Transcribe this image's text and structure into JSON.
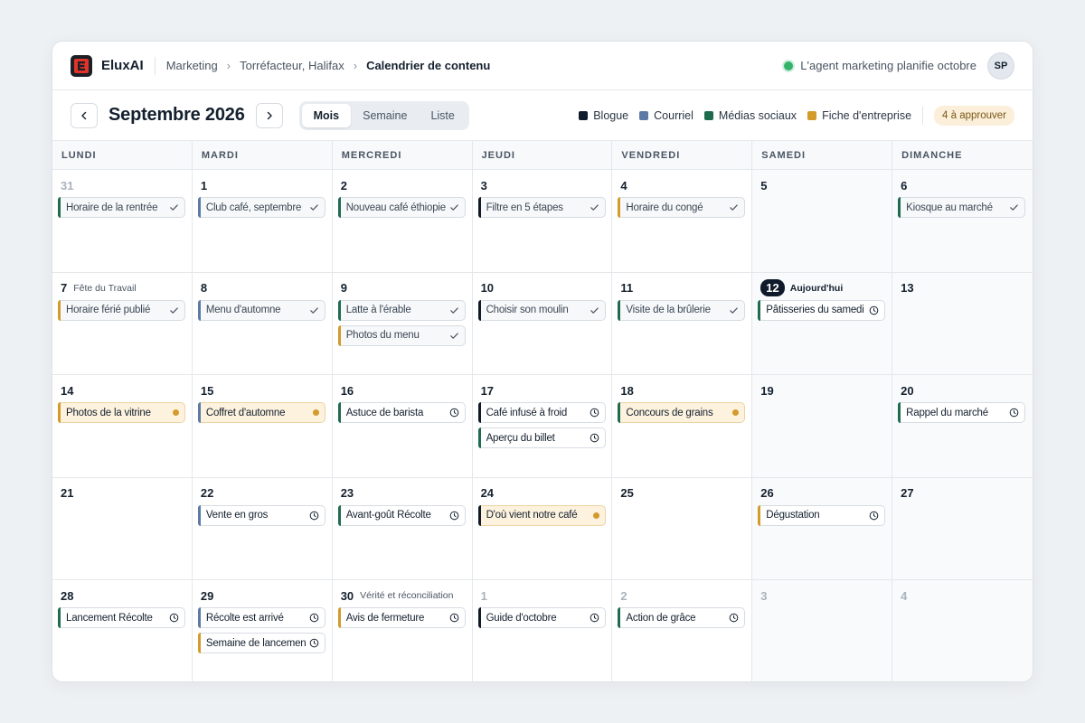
{
  "app": {
    "brand": "EluxAI"
  },
  "breadcrumb": [
    "Marketing",
    "Torréfacteur, Halifax",
    "Calendrier de contenu"
  ],
  "status": {
    "text": "L'agent marketing planifie octobre",
    "color": "#33b36b"
  },
  "user": {
    "initials": "SP"
  },
  "toolbar": {
    "month_title": "Septembre 2026",
    "views": [
      "Mois",
      "Semaine",
      "Liste"
    ],
    "active_view": "Mois",
    "approve_badge": "4 à approuver"
  },
  "legend": [
    {
      "label": "Blogue",
      "color": "#0f1a2a"
    },
    {
      "label": "Courriel",
      "color": "#5b7ba6"
    },
    {
      "label": "Médias sociaux",
      "color": "#1f6b4f"
    },
    {
      "label": "Fiche d'entreprise",
      "color": "#d39a2c"
    }
  ],
  "weekdays": [
    "LUNDI",
    "MARDI",
    "MERCREDI",
    "JEUDI",
    "VENDREDI",
    "SAMEDI",
    "DIMANCHE"
  ],
  "days": [
    {
      "num": "31",
      "muted": true,
      "events": [
        {
          "title": "Horaire de la rentrée",
          "cat": "social",
          "state": "done"
        }
      ]
    },
    {
      "num": "1",
      "events": [
        {
          "title": "Club café, septembre",
          "cat": "email",
          "state": "done"
        }
      ]
    },
    {
      "num": "2",
      "events": [
        {
          "title": "Nouveau café éthiopien",
          "cat": "social",
          "state": "done"
        }
      ]
    },
    {
      "num": "3",
      "events": [
        {
          "title": "Filtre en 5 étapes",
          "cat": "blog",
          "state": "done"
        }
      ]
    },
    {
      "num": "4",
      "events": [
        {
          "title": "Horaire du congé",
          "cat": "listing",
          "state": "done"
        }
      ]
    },
    {
      "num": "5",
      "events": []
    },
    {
      "num": "6",
      "events": [
        {
          "title": "Kiosque au marché",
          "cat": "social",
          "state": "done"
        }
      ]
    },
    {
      "num": "7",
      "note": "Fête du Travail",
      "events": [
        {
          "title": "Horaire férié publié",
          "cat": "listing",
          "state": "done"
        }
      ]
    },
    {
      "num": "8",
      "events": [
        {
          "title": "Menu d'automne",
          "cat": "email",
          "state": "done"
        }
      ]
    },
    {
      "num": "9",
      "events": [
        {
          "title": "Latte à l'érable",
          "cat": "social",
          "state": "done"
        },
        {
          "title": "Photos du menu",
          "cat": "listing",
          "state": "done"
        }
      ]
    },
    {
      "num": "10",
      "events": [
        {
          "title": "Choisir son moulin",
          "cat": "blog",
          "state": "done"
        }
      ]
    },
    {
      "num": "11",
      "events": [
        {
          "title": "Visite de la brûlerie",
          "cat": "social",
          "state": "done"
        }
      ]
    },
    {
      "num": "12",
      "today": true,
      "note": "Aujourd'hui",
      "events": [
        {
          "title": "Pâtisseries du samedi",
          "cat": "social",
          "state": "scheduled"
        }
      ]
    },
    {
      "num": "13",
      "events": []
    },
    {
      "num": "14",
      "events": [
        {
          "title": "Photos de la vitrine",
          "cat": "listing",
          "state": "pending"
        }
      ]
    },
    {
      "num": "15",
      "events": [
        {
          "title": "Coffret d'automne",
          "cat": "email",
          "state": "pending"
        }
      ]
    },
    {
      "num": "16",
      "events": [
        {
          "title": "Astuce de barista",
          "cat": "social",
          "state": "scheduled"
        }
      ]
    },
    {
      "num": "17",
      "events": [
        {
          "title": "Café infusé à froid",
          "cat": "blog",
          "state": "scheduled"
        },
        {
          "title": "Aperçu du billet",
          "cat": "social",
          "state": "scheduled"
        }
      ]
    },
    {
      "num": "18",
      "events": [
        {
          "title": "Concours de grains",
          "cat": "social",
          "state": "pending"
        }
      ]
    },
    {
      "num": "19",
      "events": []
    },
    {
      "num": "20",
      "events": [
        {
          "title": "Rappel du marché",
          "cat": "social",
          "state": "scheduled"
        }
      ]
    },
    {
      "num": "21",
      "events": []
    },
    {
      "num": "22",
      "events": [
        {
          "title": "Vente en gros",
          "cat": "email",
          "state": "scheduled"
        }
      ]
    },
    {
      "num": "23",
      "events": [
        {
          "title": "Avant-goût Récolte",
          "cat": "social",
          "state": "scheduled"
        }
      ]
    },
    {
      "num": "24",
      "events": [
        {
          "title": "D'où vient notre café",
          "cat": "blog",
          "state": "pending"
        }
      ]
    },
    {
      "num": "25",
      "events": []
    },
    {
      "num": "26",
      "events": [
        {
          "title": "Dégustation",
          "cat": "listing",
          "state": "scheduled"
        }
      ]
    },
    {
      "num": "27",
      "events": []
    },
    {
      "num": "28",
      "events": [
        {
          "title": "Lancement Récolte",
          "cat": "social",
          "state": "scheduled"
        }
      ]
    },
    {
      "num": "29",
      "events": [
        {
          "title": "Récolte est arrivé",
          "cat": "email",
          "state": "scheduled"
        },
        {
          "title": "Semaine de lancement",
          "cat": "listing",
          "state": "scheduled"
        }
      ]
    },
    {
      "num": "30",
      "note": "Vérité et réconciliation",
      "events": [
        {
          "title": "Avis de fermeture",
          "cat": "listing",
          "state": "scheduled"
        }
      ]
    },
    {
      "num": "1",
      "muted": true,
      "events": [
        {
          "title": "Guide d'octobre",
          "cat": "blog",
          "state": "scheduled"
        }
      ]
    },
    {
      "num": "2",
      "muted": true,
      "events": [
        {
          "title": "Action de grâce",
          "cat": "social",
          "state": "scheduled"
        }
      ]
    },
    {
      "num": "3",
      "muted": true,
      "events": []
    },
    {
      "num": "4",
      "muted": true,
      "events": []
    }
  ],
  "category_colors": {
    "blog": "#0f1a2a",
    "email": "#5b7ba6",
    "social": "#1f6b4f",
    "listing": "#d39a2c"
  },
  "icons": {
    "done": "check-icon",
    "scheduled": "clock-icon",
    "pending": "pending-dot-icon",
    "prev": "chevron-left-icon",
    "next": "chevron-right-icon",
    "logo": "e-logo-icon",
    "breadcrumb_sep": "chevron-right-icon"
  }
}
